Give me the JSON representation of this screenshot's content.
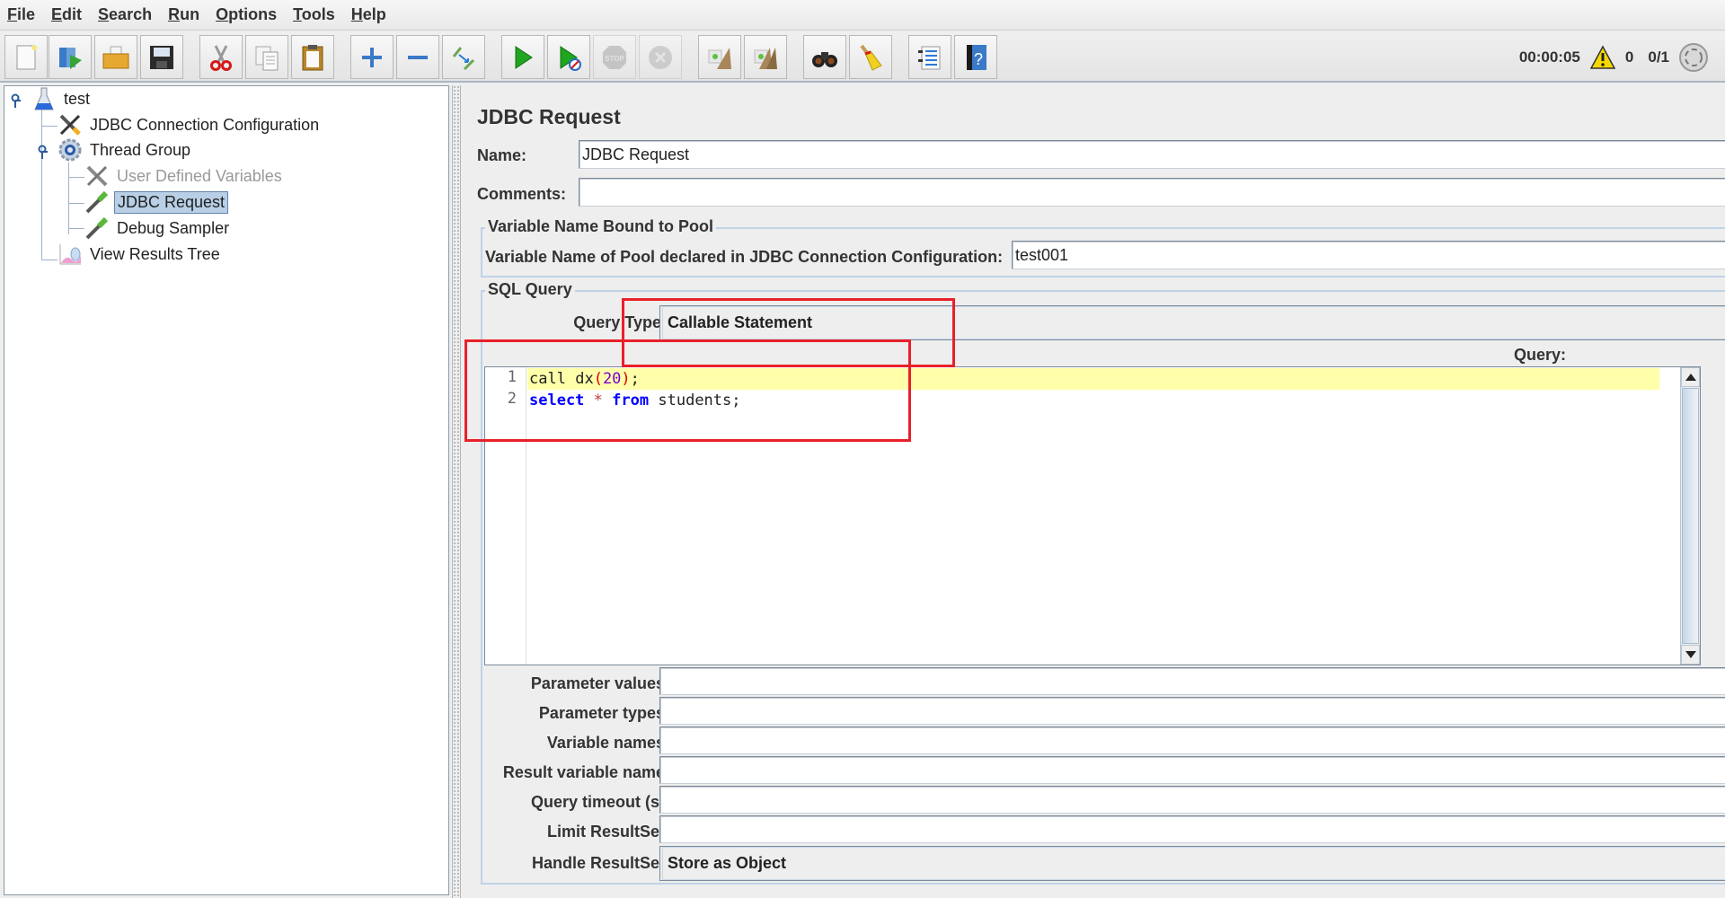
{
  "menu": [
    {
      "label": "File",
      "mnemonic": "F",
      "rest": "ile"
    },
    {
      "label": "Edit",
      "mnemonic": "E",
      "rest": "dit"
    },
    {
      "label": "Search",
      "mnemonic": "S",
      "rest": "earch"
    },
    {
      "label": "Run",
      "mnemonic": "R",
      "rest": "un"
    },
    {
      "label": "Options",
      "mnemonic": "O",
      "rest": "ptions"
    },
    {
      "label": "Tools",
      "mnemonic": "T",
      "rest": "ools"
    },
    {
      "label": "Help",
      "mnemonic": "H",
      "rest": "elp"
    }
  ],
  "toolbar": {
    "buttons": [
      {
        "icon": "new-document-icon",
        "tooltip": "New"
      },
      {
        "icon": "templates-icon",
        "tooltip": "Templates"
      },
      {
        "icon": "open-folder-icon",
        "tooltip": "Open"
      },
      {
        "icon": "save-icon",
        "tooltip": "Save"
      },
      {
        "icon": "cut-icon",
        "tooltip": "Cut"
      },
      {
        "icon": "copy-icon",
        "tooltip": "Copy"
      },
      {
        "icon": "paste-icon",
        "tooltip": "Paste"
      },
      {
        "icon": "expand-icon",
        "tooltip": "Expand All"
      },
      {
        "icon": "collapse-icon",
        "tooltip": "Collapse All"
      },
      {
        "icon": "toggle-icon",
        "tooltip": "Toggle"
      },
      {
        "icon": "start-icon",
        "tooltip": "Start"
      },
      {
        "icon": "start-no-pauses-icon",
        "tooltip": "Start no pauses"
      },
      {
        "icon": "stop-icon",
        "tooltip": "Stop",
        "disabled": true
      },
      {
        "icon": "shutdown-icon",
        "tooltip": "Shutdown",
        "disabled": true
      },
      {
        "icon": "clear-icon",
        "tooltip": "Clear"
      },
      {
        "icon": "clear-all-icon",
        "tooltip": "Clear All"
      },
      {
        "icon": "search-binoculars-icon",
        "tooltip": "Search"
      },
      {
        "icon": "reset-search-broom-icon",
        "tooltip": "Reset Search"
      },
      {
        "icon": "function-helper-icon",
        "tooltip": "Function Helper Dialog"
      },
      {
        "icon": "help-icon",
        "tooltip": "Help"
      }
    ]
  },
  "status": {
    "elapsed": "00:00:05",
    "warnings": "0",
    "threads": "0/1",
    "colors": {
      "warning": "#f5d800"
    }
  },
  "tree": {
    "nodes": [
      {
        "label": "test",
        "icon": "test-plan-flask-icon",
        "state": "normal"
      },
      {
        "label": "JDBC Connection Configuration",
        "icon": "config-tools-icon",
        "state": "normal"
      },
      {
        "label": "Thread Group",
        "icon": "thread-group-gear-icon",
        "state": "normal"
      },
      {
        "label": "User Defined Variables",
        "icon": "config-tools-icon",
        "state": "disabled"
      },
      {
        "label": "JDBC Request",
        "icon": "sampler-pipette-icon",
        "state": "selected"
      },
      {
        "label": "Debug Sampler",
        "icon": "sampler-pipette-icon",
        "state": "normal"
      },
      {
        "label": "View Results Tree",
        "icon": "listener-graph-icon",
        "state": "normal"
      }
    ]
  },
  "form": {
    "title": "JDBC Request",
    "name_label": "Name:",
    "name_value": "JDBC Request",
    "comments_label": "Comments:",
    "comments_value": "",
    "pool_group": {
      "legend": "Variable Name Bound to Pool",
      "label": "Variable Name of Pool declared in JDBC Connection Configuration:",
      "value": "test001"
    },
    "sql_group": {
      "legend": "SQL Query",
      "query_type_label": "Query Type:",
      "query_type_value": "Callable Statement",
      "query_label": "Query:",
      "code_lines": [
        {
          "number": "1",
          "text": "call dx(20);"
        },
        {
          "number": "2",
          "text": "select * from students;"
        }
      ],
      "fields": [
        {
          "label": "Parameter values:",
          "value": ""
        },
        {
          "label": "Parameter types:",
          "value": ""
        },
        {
          "label": "Variable names:",
          "value": ""
        },
        {
          "label": "Result variable name:",
          "value": ""
        },
        {
          "label": "Query timeout (s):",
          "value": ""
        },
        {
          "label": "Limit ResultSet:",
          "value": ""
        }
      ],
      "handle_resultset_label": "Handle ResultSet:",
      "handle_resultset_value": "Store as Object"
    }
  },
  "annotations": {
    "color": "#e8202a"
  }
}
